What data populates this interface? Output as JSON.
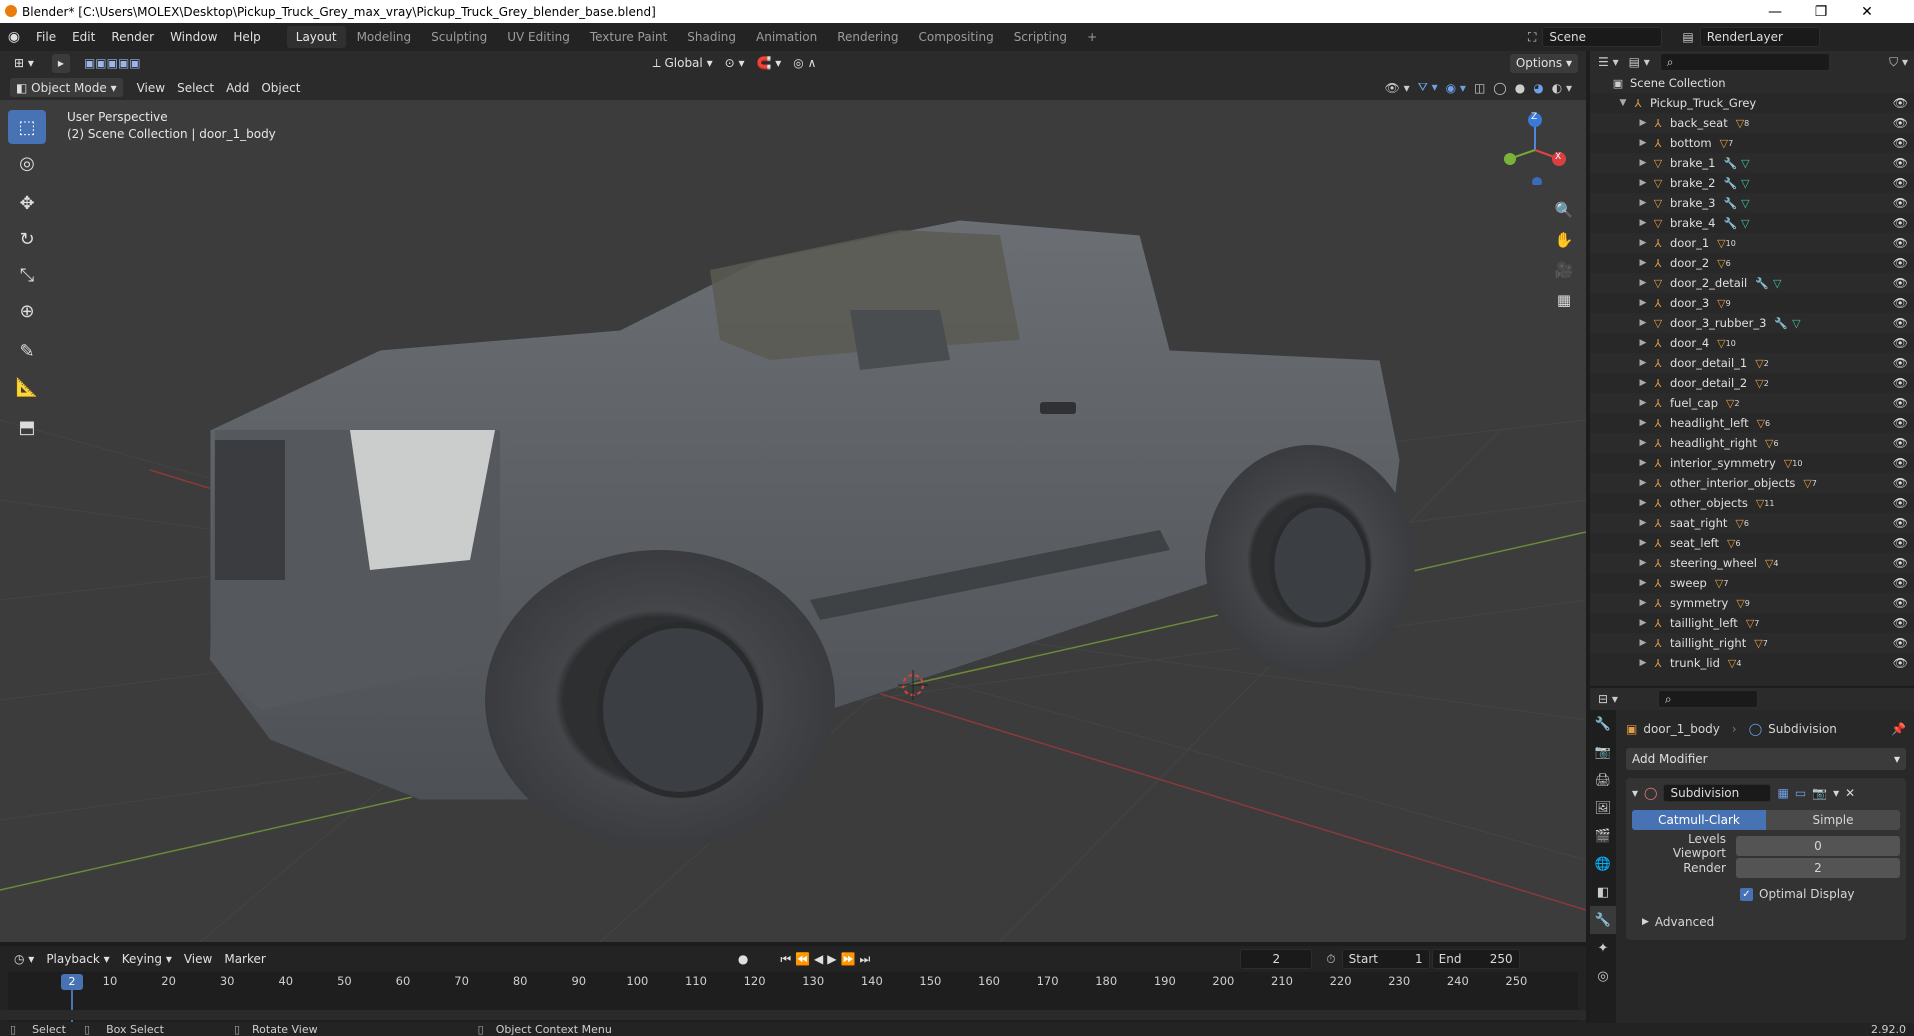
{
  "titlebar": {
    "title": "Blender* [C:\\Users\\MOLEX\\Desktop\\Pickup_Truck_Grey_max_vray\\Pickup_Truck_Grey_blender_base.blend]",
    "minimize": "—",
    "maximize": "❐",
    "close": "✕"
  },
  "menubar": {
    "menus": [
      "File",
      "Edit",
      "Render",
      "Window",
      "Help"
    ],
    "workspaces": [
      "Layout",
      "Modeling",
      "Sculpting",
      "UV Editing",
      "Texture Paint",
      "Shading",
      "Animation",
      "Rendering",
      "Compositing",
      "Scripting"
    ],
    "active_workspace": "Layout",
    "add_workspace": "+",
    "scene": "Scene",
    "render_layer": "RenderLayer"
  },
  "viewport_header": {
    "transform_orientation": "Global",
    "options": "Options",
    "mode": "Object Mode",
    "menus": [
      "View",
      "Select",
      "Add",
      "Object"
    ]
  },
  "viewport": {
    "perspective_label": "User Perspective",
    "collection_label": "(2) Scene Collection | door_1_body",
    "gizmo": {
      "z": "Z",
      "x": "X",
      "y": "Y"
    }
  },
  "outliner": {
    "root": "Scene Collection",
    "collection": "Pickup_Truck_Grey",
    "items": [
      {
        "name": "back_seat",
        "badge": "8",
        "type": "empty"
      },
      {
        "name": "bottom",
        "badge": "7",
        "type": "empty"
      },
      {
        "name": "brake_1",
        "badge": "",
        "type": "mesh"
      },
      {
        "name": "brake_2",
        "badge": "",
        "type": "mesh"
      },
      {
        "name": "brake_3",
        "badge": "",
        "type": "mesh"
      },
      {
        "name": "brake_4",
        "badge": "",
        "type": "mesh"
      },
      {
        "name": "door_1",
        "badge": "10",
        "type": "empty"
      },
      {
        "name": "door_2",
        "badge": "6",
        "type": "empty"
      },
      {
        "name": "door_2_detail",
        "badge": "",
        "type": "mesh"
      },
      {
        "name": "door_3",
        "badge": "9",
        "type": "empty"
      },
      {
        "name": "door_3_rubber_3",
        "badge": "",
        "type": "mesh"
      },
      {
        "name": "door_4",
        "badge": "10",
        "type": "empty"
      },
      {
        "name": "door_detail_1",
        "badge": "2",
        "type": "empty"
      },
      {
        "name": "door_detail_2",
        "badge": "2",
        "type": "empty"
      },
      {
        "name": "fuel_cap",
        "badge": "2",
        "type": "empty"
      },
      {
        "name": "headlight_left",
        "badge": "6",
        "type": "empty"
      },
      {
        "name": "headlight_right",
        "badge": "6",
        "type": "empty"
      },
      {
        "name": "interior_symmetry",
        "badge": "10",
        "type": "empty"
      },
      {
        "name": "other_interior_objects",
        "badge": "7",
        "type": "empty"
      },
      {
        "name": "other_objects",
        "badge": "11",
        "type": "empty"
      },
      {
        "name": "saat_right",
        "badge": "6",
        "type": "empty"
      },
      {
        "name": "seat_left",
        "badge": "6",
        "type": "empty"
      },
      {
        "name": "steering_wheel",
        "badge": "4",
        "type": "empty"
      },
      {
        "name": "sweep",
        "badge": "7",
        "type": "empty"
      },
      {
        "name": "symmetry",
        "badge": "9",
        "type": "empty"
      },
      {
        "name": "taillight_left",
        "badge": "7",
        "type": "empty"
      },
      {
        "name": "taillight_right",
        "badge": "7",
        "type": "empty"
      },
      {
        "name": "trunk_lid",
        "badge": "4",
        "type": "empty"
      }
    ]
  },
  "properties": {
    "object": "door_1_body",
    "modifier_context": "Subdivision",
    "add_modifier": "Add Modifier",
    "modifier_name": "Subdivision",
    "algo_catmull": "Catmull-Clark",
    "algo_simple": "Simple",
    "levels_viewport_label": "Levels Viewport",
    "levels_viewport_value": "0",
    "render_label": "Render",
    "render_value": "2",
    "optimal_display": "Optimal Display",
    "advanced": "Advanced"
  },
  "timeline": {
    "menus": [
      "Playback",
      "Keying",
      "View",
      "Marker"
    ],
    "current_frame": "2",
    "start_label": "Start",
    "start_value": "1",
    "end_label": "End",
    "end_value": "250",
    "ticks": [
      "10",
      "20",
      "30",
      "40",
      "50",
      "60",
      "70",
      "80",
      "90",
      "100",
      "110",
      "120",
      "130",
      "140",
      "150",
      "160",
      "170",
      "180",
      "190",
      "200",
      "210",
      "220",
      "230",
      "240",
      "250"
    ],
    "playhead": "2"
  },
  "statusbar": {
    "select": "Select",
    "box_select": "Box Select",
    "rotate_view": "Rotate View",
    "context_menu": "Object Context Menu",
    "version": "2.92.0"
  },
  "colors": {
    "accent": "#4772b3",
    "object_orange": "#e59d45",
    "mesh_green": "#3ec1a5"
  }
}
